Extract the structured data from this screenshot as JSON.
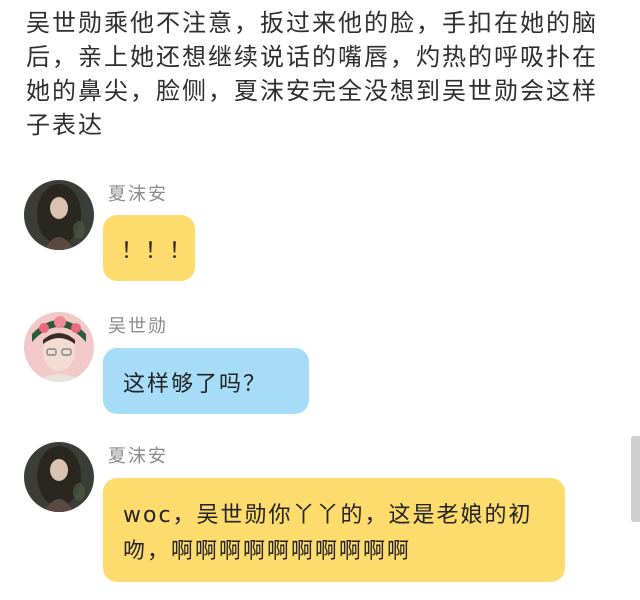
{
  "narration": "吴世勋乘他不注意，扳过来他的脸，手扣在她的脑后，亲上她还想继续说话的嘴唇，灼热的呼吸扑在她的鼻尖，脸侧，夏沫安完全没想到吴世勋会这样子表达",
  "messages": [
    {
      "sender": "夏沫安",
      "text": "！！！",
      "bubble_color": "#fddb6d"
    },
    {
      "sender": "吴世勋",
      "text": "这样够了吗？",
      "bubble_color": "#a6dcf7"
    },
    {
      "sender": "夏沫安",
      "text": "woc，吴世勋你丫丫的，这是老娘的初吻，啊啊啊啊啊啊啊啊啊啊",
      "bubble_color": "#fddb6d"
    }
  ],
  "icons": {
    "avatar_female": "avatar-xia-moan-icon",
    "avatar_male": "avatar-wu-shixun-icon"
  }
}
